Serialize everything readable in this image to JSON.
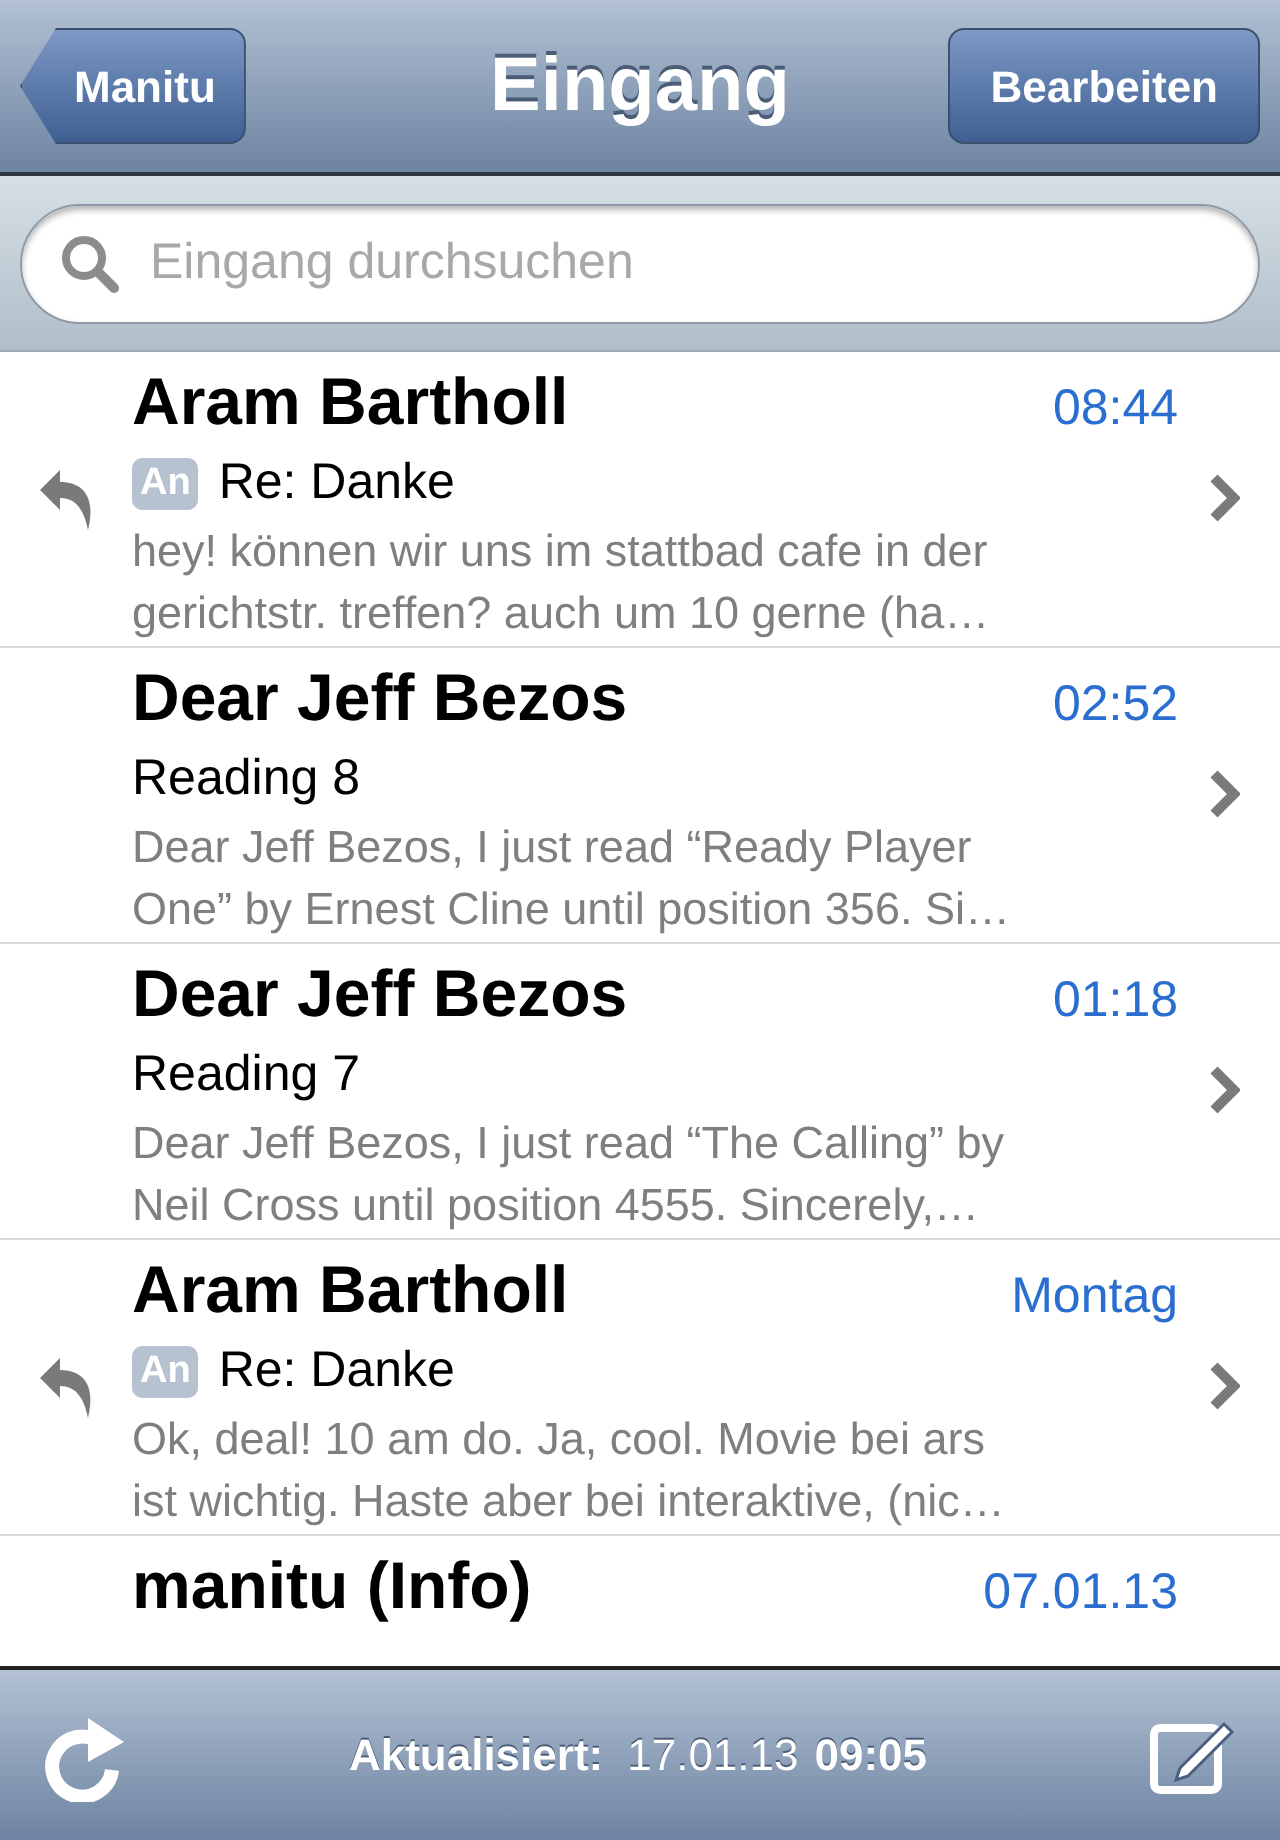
{
  "nav": {
    "back": "Manitu",
    "title": "Eingang",
    "edit": "Bearbeiten"
  },
  "search": {
    "placeholder": "Eingang durchsuchen"
  },
  "messages": [
    {
      "sender": "Aram Bartholl",
      "time": "08:44",
      "replied": true,
      "badge": "An",
      "subject": "Re: Danke",
      "preview_lines": [
        "hey! können wir uns im stattbad cafe in der",
        "gerichtstr. treffen? auch um 10 gerne (ha…"
      ]
    },
    {
      "sender": "Dear Jeff Bezos",
      "time": "02:52",
      "replied": false,
      "subject": "Reading 8",
      "preview_lines": [
        "Dear Jeff Bezos, I just read “Ready Player",
        "One” by Ernest Cline until position 356. Si…"
      ]
    },
    {
      "sender": "Dear Jeff Bezos",
      "time": "01:18",
      "replied": false,
      "subject": "Reading 7",
      "preview_lines": [
        "Dear Jeff Bezos, I just read “The Calling” by",
        "Neil Cross until position 4555. Sincerely,…"
      ]
    },
    {
      "sender": "Aram Bartholl",
      "time": "Montag",
      "replied": true,
      "badge": "An",
      "subject": "Re: Danke",
      "preview_lines": [
        "Ok, deal! 10 am do. Ja, cool. Movie bei ars",
        "ist wichtig. Haste aber bei interaktive, (nic…"
      ]
    },
    {
      "sender": "manitu (Info)",
      "time": "07.01.13"
    }
  ],
  "toolbar": {
    "label": "Aktualisiert:",
    "date": "17.01.13",
    "time": "09:05"
  }
}
